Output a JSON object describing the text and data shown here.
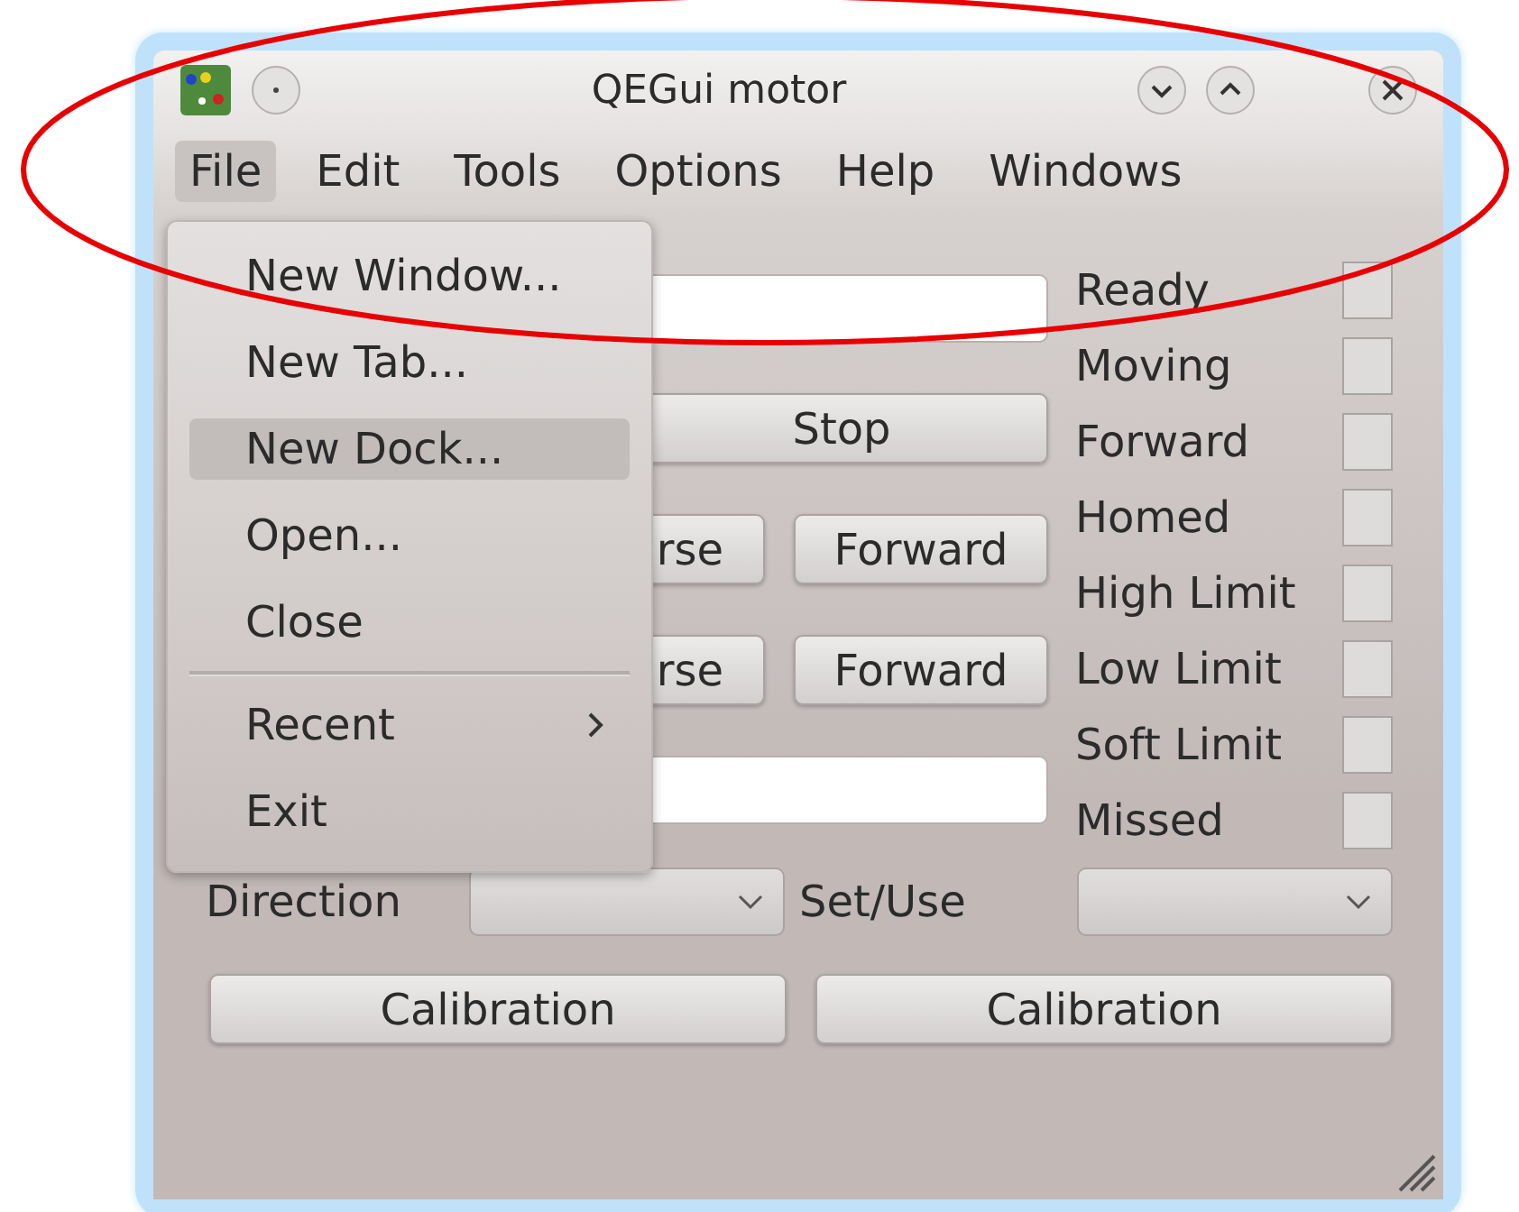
{
  "window": {
    "title": "QEGui motor"
  },
  "menubar": [
    {
      "label": "File",
      "selected": true
    },
    {
      "label": "Edit",
      "selected": false
    },
    {
      "label": "Tools",
      "selected": false
    },
    {
      "label": "Options",
      "selected": false
    },
    {
      "label": "Help",
      "selected": false
    },
    {
      "label": "Windows",
      "selected": false
    }
  ],
  "file_menu": [
    {
      "kind": "item",
      "label": "New Window...",
      "selected": false
    },
    {
      "kind": "item",
      "label": "New Tab...",
      "selected": false
    },
    {
      "kind": "item",
      "label": "New Dock...",
      "selected": true
    },
    {
      "kind": "item",
      "label": "Open...",
      "selected": false
    },
    {
      "kind": "item",
      "label": "Close",
      "selected": false
    },
    {
      "kind": "separator"
    },
    {
      "kind": "submenu",
      "label": "Recent",
      "selected": false
    },
    {
      "kind": "item",
      "label": "Exit",
      "selected": false
    }
  ],
  "form": [
    {
      "kind": "field"
    },
    {
      "kind": "button",
      "label": "Stop"
    },
    {
      "kind": "pair",
      "left": "rse",
      "right": "Forward"
    },
    {
      "kind": "pair",
      "left": "rse",
      "right": "Forward"
    },
    {
      "kind": "field"
    }
  ],
  "status": [
    {
      "label": "Ready",
      "checked": false
    },
    {
      "label": "Moving",
      "checked": false
    },
    {
      "label": "Forward",
      "checked": false
    },
    {
      "label": "Homed",
      "checked": false
    },
    {
      "label": "High Limit",
      "checked": false
    },
    {
      "label": "Low Limit",
      "checked": false
    },
    {
      "label": "Soft Limit",
      "checked": false
    },
    {
      "label": "Missed",
      "checked": false
    }
  ],
  "selectors": [
    {
      "label": "Direction"
    },
    {
      "label": "Set/Use"
    }
  ],
  "calibration": [
    "Calibration",
    "Calibration"
  ],
  "annotation": {
    "kind": "ellipse"
  }
}
